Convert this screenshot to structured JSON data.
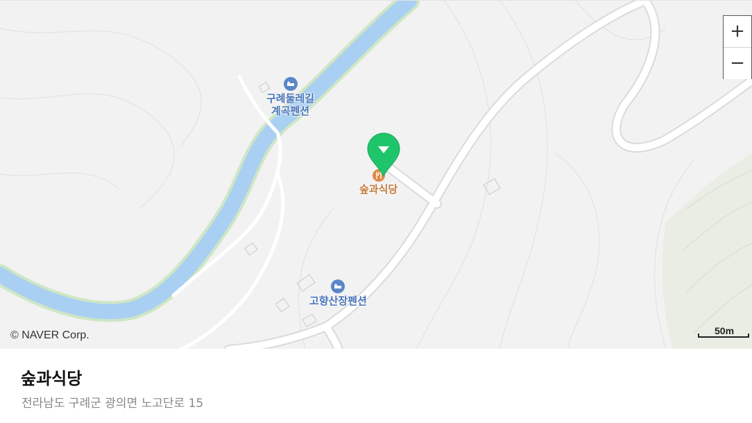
{
  "map": {
    "pois": [
      {
        "name": "구례둘레길\n계곡펜션",
        "line1": "구례둘레길",
        "line2": "계곡펜션",
        "icon": "lodging-icon",
        "color": "#4a74b8"
      },
      {
        "name": "고향산장펜션",
        "line1": "고향산장펜션",
        "icon": "lodging-icon",
        "color": "#4a74b8"
      },
      {
        "name": "숲과식당",
        "line1": "숲과식당",
        "icon": "restaurant-icon",
        "color": "#c27a3c"
      }
    ],
    "marker": {
      "icon": "location-pin-icon",
      "color": "#1fc56b"
    },
    "zoom_in_label": "+",
    "zoom_out_label": "−",
    "copyright": "© NAVER Corp.",
    "scale_label": "50m",
    "colors": {
      "river": "#a9d0f2",
      "river_bank": "#cfe6c4",
      "road": "#ffffff",
      "background": "#f2f2f2"
    }
  },
  "place": {
    "title": "숲과식당",
    "address": "전라남도 구례군 광의면 노고단로 15"
  }
}
